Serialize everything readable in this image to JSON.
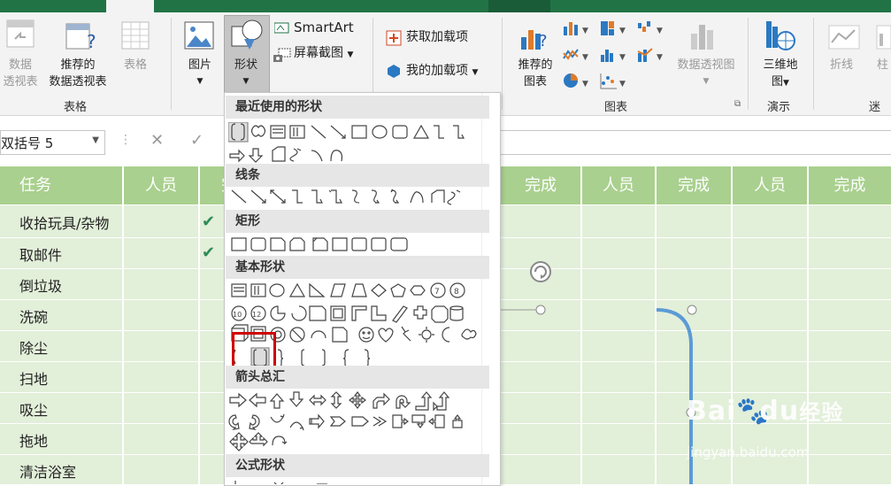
{
  "ribbon": {
    "pivot_label_1": "数据",
    "pivot_label_2": "透视表",
    "rec_pivot_1": "推荐的",
    "rec_pivot_2": "数据透视表",
    "table": "表格",
    "picture": "图片",
    "shapes": "形状",
    "smartart": "SmartArt",
    "screenshot": "屏幕截图",
    "get_addins": "获取加载项",
    "my_addins": "我的加载项",
    "rec_chart_1": "推荐的",
    "rec_chart_2": "图表",
    "pivot_chart": "数据透视图",
    "map3d_1": "三维地",
    "map3d_2": "图",
    "line": "折线",
    "column": "柱",
    "group_table": "表格",
    "group_chart": "图表",
    "group_tour": "演示",
    "group_spark": "迷你"
  },
  "formula": {
    "name_box": "双括号 5",
    "cancel": "✕",
    "enter": "✓"
  },
  "sheet": {
    "headers": [
      "任务",
      "人员",
      "完成",
      "完成",
      "人员",
      "完成",
      "人员",
      "完成"
    ],
    "tasks": [
      "收拾玩具/杂物",
      "取邮件",
      "倒垃圾",
      "洗碗",
      "除尘",
      "扫地",
      "吸尘",
      "拖地",
      "清洁浴室"
    ],
    "checks": [
      "✔",
      "✔"
    ]
  },
  "dropdown": {
    "recent": "最近使用的形状",
    "lines": "线条",
    "rects": "矩形",
    "basic": "基本形状",
    "arrows": "箭头总汇",
    "equation": "公式形状"
  },
  "colors": {
    "excel_green": "#217346",
    "header_green": "#a9d08e",
    "row_green": "#e2efd9",
    "highlight_red": "#d00000",
    "connector_blue": "#5b9bd5"
  },
  "watermark": {
    "brand": "Bai",
    "brand2": "du",
    "brand3": "经验",
    "url": "jingyan.baidu.com"
  }
}
